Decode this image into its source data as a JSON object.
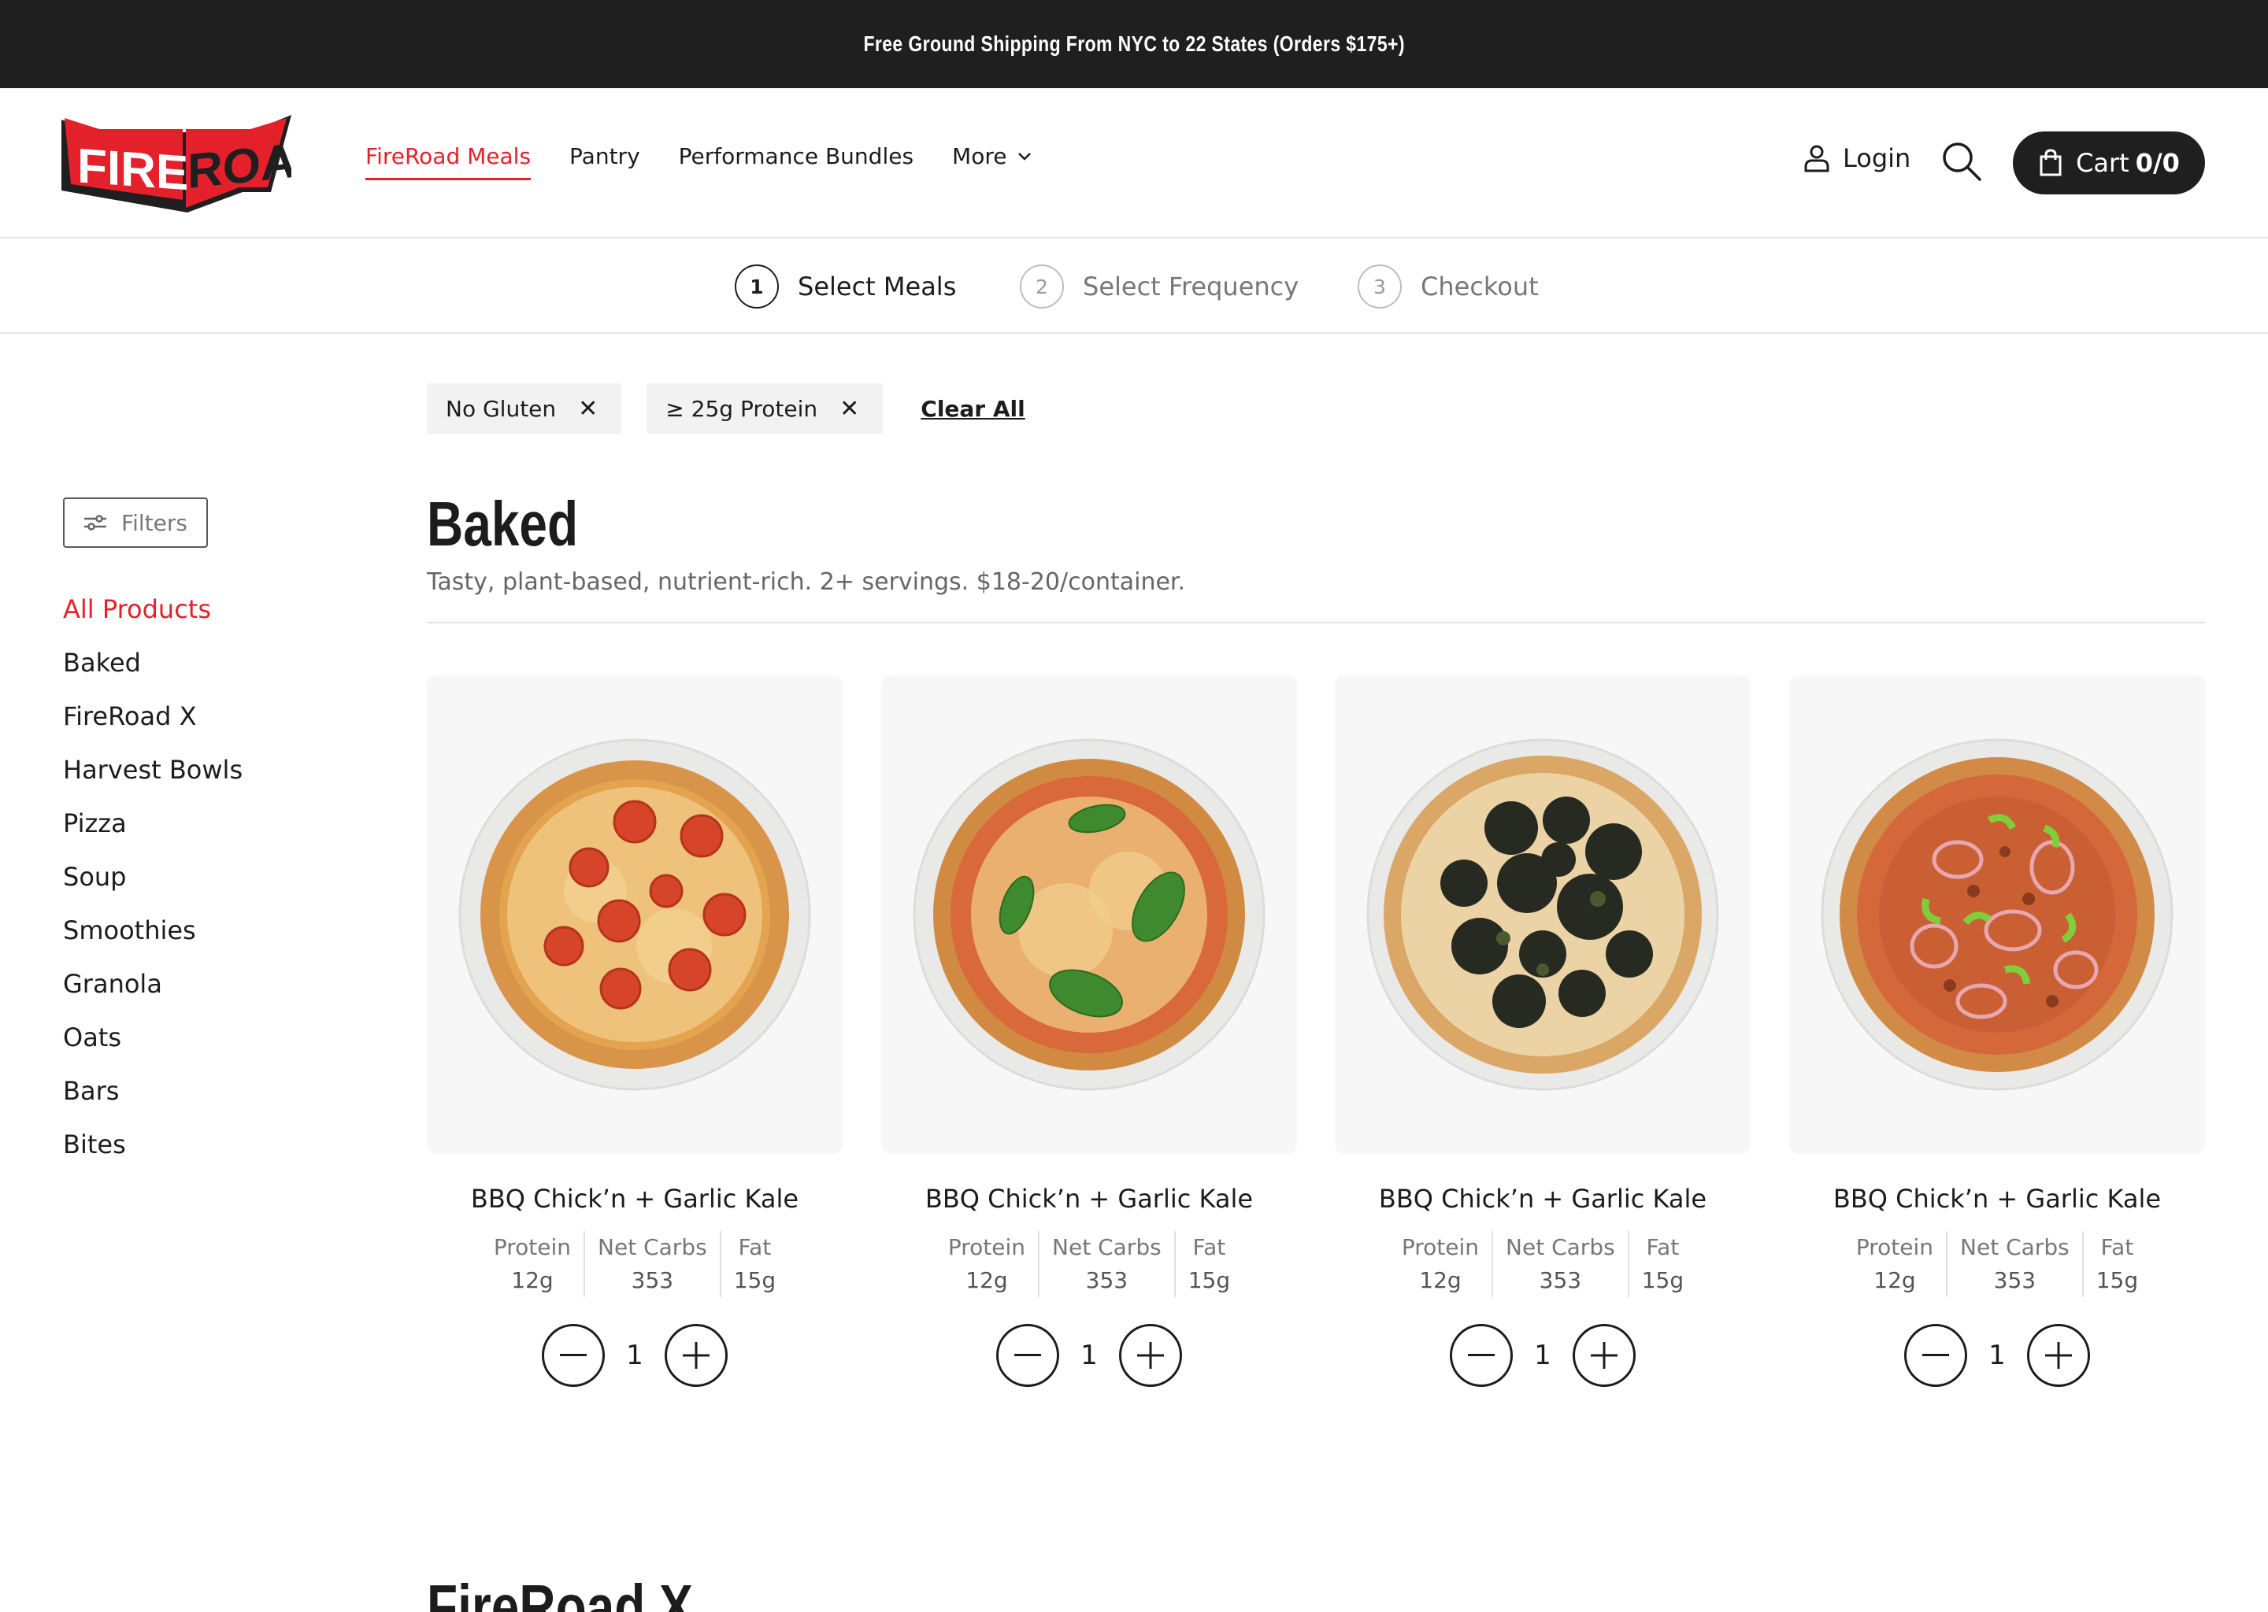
{
  "announcement": "Free Ground Shipping From NYC to 22 States (Orders $175+)",
  "brand": {
    "logo_text": "FIREROAD",
    "accent": "#e4212b",
    "dark": "#1f1f1f"
  },
  "nav": {
    "items": [
      {
        "label": "FireRoad Meals",
        "active": true
      },
      {
        "label": "Pantry"
      },
      {
        "label": "Performance Bundles"
      },
      {
        "label": "More",
        "icon": "chevron-down-icon"
      }
    ]
  },
  "header": {
    "login_label": "Login",
    "cart_label": "Cart",
    "cart_count": "0/0"
  },
  "steps": [
    {
      "num": "1",
      "label": "Select Meals",
      "current": true
    },
    {
      "num": "2",
      "label": "Select Frequency"
    },
    {
      "num": "3",
      "label": "Checkout"
    }
  ],
  "active_filters": [
    "No Gluten",
    "≥ 25g Protein"
  ],
  "clear_all": "Clear All",
  "sidebar": {
    "filters_label": "Filters",
    "categories": [
      "All Products",
      "Baked",
      "FireRoad X",
      "Harvest Bowls",
      "Pizza",
      "Soup",
      "Smoothies",
      "Granola",
      "Oats",
      "Bars",
      "Bites"
    ]
  },
  "section": {
    "title": "Baked",
    "description": "Tasty, plant-based, nutrient-rich. 2+ servings. $18-20/container.",
    "next_title": "FireRoad X"
  },
  "products": [
    {
      "name": "BBQ Chick’n + Garlic Kale",
      "protein_label": "Protein",
      "protein": "12g",
      "carbs_label": "Net Carbs",
      "carbs": "353",
      "fat_label": "Fat",
      "fat": "15g",
      "qty": "1",
      "image": "pepperoni-pizza-image"
    },
    {
      "name": "BBQ Chick’n + Garlic Kale",
      "protein_label": "Protein",
      "protein": "12g",
      "carbs_label": "Net Carbs",
      "carbs": "353",
      "fat_label": "Fat",
      "fat": "15g",
      "qty": "1",
      "image": "margherita-pizza-image"
    },
    {
      "name": "BBQ Chick’n + Garlic Kale",
      "protein_label": "Protein",
      "protein": "12g",
      "carbs_label": "Net Carbs",
      "carbs": "353",
      "fat_label": "Fat",
      "fat": "15g",
      "qty": "1",
      "image": "kale-pizza-image"
    },
    {
      "name": "BBQ Chick’n + Garlic Kale",
      "protein_label": "Protein",
      "protein": "12g",
      "carbs_label": "Net Carbs",
      "carbs": "353",
      "fat_label": "Fat",
      "fat": "15g",
      "qty": "1",
      "image": "supreme-pizza-image"
    }
  ]
}
